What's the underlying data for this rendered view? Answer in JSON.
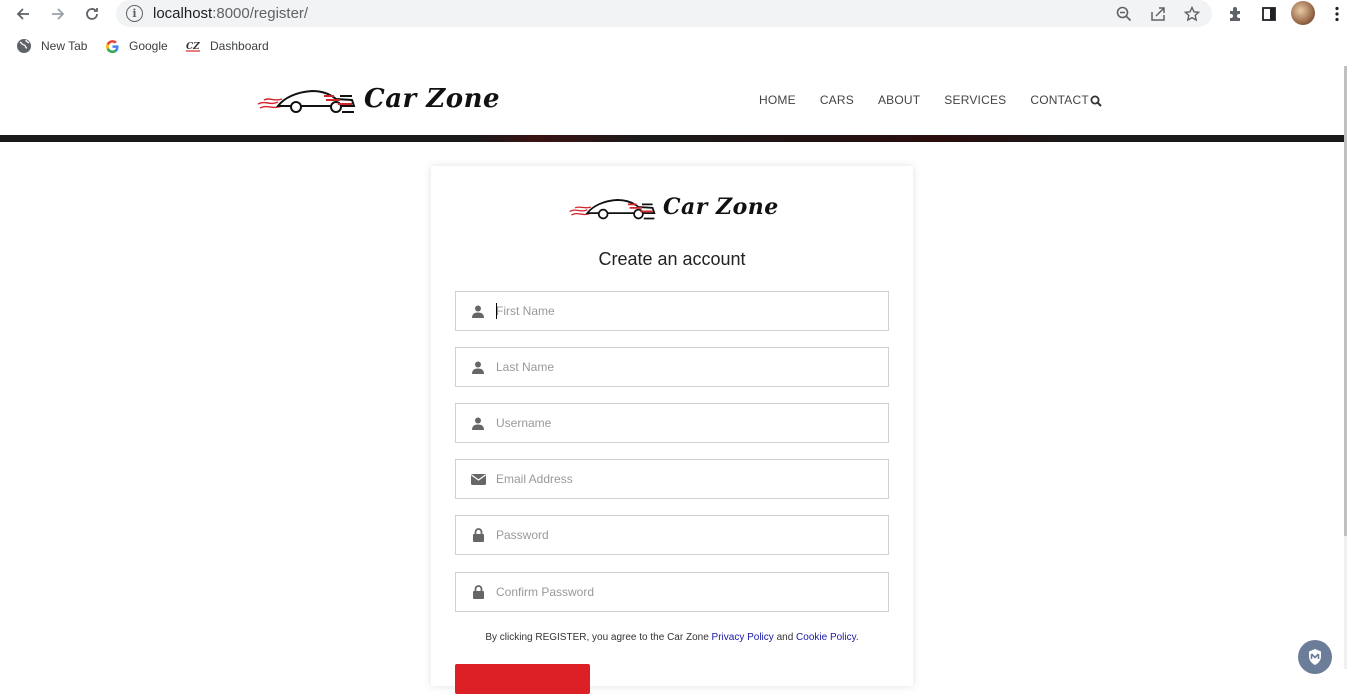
{
  "browser": {
    "url_host": "localhost",
    "url_path": ":8000/register/",
    "bookmarks": [
      {
        "label": "New Tab",
        "icon": "globe-icon"
      },
      {
        "label": "Google",
        "icon": "google-icon"
      },
      {
        "label": "Dashboard",
        "icon": "carzone-favicon"
      }
    ]
  },
  "site": {
    "logo_text": "Car Zone",
    "nav": [
      "HOME",
      "CARS",
      "ABOUT",
      "SERVICES",
      "CONTACT"
    ]
  },
  "form": {
    "title": "Create an account",
    "fields": [
      {
        "placeholder": "First Name",
        "icon": "user-icon"
      },
      {
        "placeholder": "Last Name",
        "icon": "user-icon"
      },
      {
        "placeholder": "Username",
        "icon": "user-icon"
      },
      {
        "placeholder": "Email Address",
        "icon": "envelope-icon"
      },
      {
        "placeholder": "Password",
        "icon": "lock-icon"
      },
      {
        "placeholder": "Confirm Password",
        "icon": "lock-icon"
      }
    ],
    "terms_prefix": "By clicking REGISTER, you agree to the Car Zone ",
    "privacy_link": "Privacy Policy",
    "terms_and": " and ",
    "cookie_link": "Cookie Policy",
    "terms_suffix": "."
  },
  "colors": {
    "accent": "#dd1f26",
    "link": "#1a1aa6"
  }
}
